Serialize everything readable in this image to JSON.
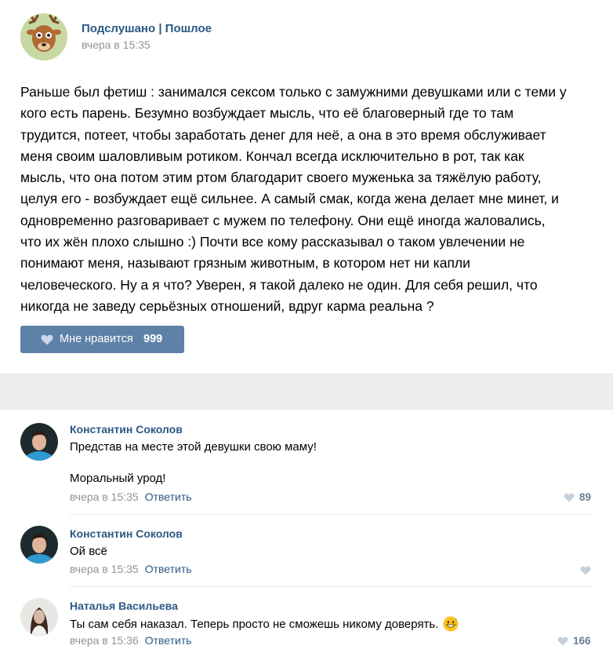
{
  "post": {
    "group_name": "Подслушано | Пошлое",
    "time": "вчера в 15:35",
    "lines": [
      "Раньше был фетиш : занимался сексом только с замужними девушками или с теми у",
      "кого есть парень. Безумно возбуждает мысль, что её благоверный где то там",
      "трудится, потеет, чтобы заработать денег для неё, а она в это время обслуживает",
      "меня своим шаловливым ротиком. Кончал всегда исключительно в рот, так как",
      "мысль, что она потом этим ртом благодарит своего муженька за тяжёлую работу,",
      "целуя его - возбуждает ещё сильнее. А самый смак, когда жена делает мне минет, и",
      "одновременно разговаривает с мужем по телефону. Они ещё иногда жаловались,",
      "что их жён плохо слышно :) Почти все кому рассказывал о таком увлечении не",
      "понимают меня, называют грязным животным, в котором нет ни капли",
      "человеческого. Ну а я что? Уверен, я такой далеко не один. Для себя решил, что",
      "никогда не заведу серьёзных отношений, вдруг карма реальна ?"
    ],
    "like_label": "Мне нравится",
    "like_count": "999"
  },
  "comments": [
    {
      "author": "Константин Соколов",
      "text_line1": "Представ на месте этой девушки свою маму!",
      "text_line2": "Моральный урод!",
      "time": "вчера в 15:35",
      "reply_label": "Ответить",
      "likes": "89"
    },
    {
      "author": "Константин Соколов",
      "text_line1": "Ой всё",
      "time": "вчера в 15:35",
      "reply_label": "Ответить",
      "likes": ""
    },
    {
      "author": "Наталья Васильева",
      "text_line1": "Ты сам себя наказал. Теперь просто не сможешь никому доверять.",
      "time": "вчера в 15:36",
      "reply_label": "Ответить",
      "likes": "166"
    }
  ],
  "icons": {
    "like": "heart-icon",
    "emoji": "grinning-sweat-emoji"
  },
  "colors": {
    "link": "#2a5885",
    "like_button": "#5e81a8",
    "muted": "#939393",
    "like_heart": "#c5d0db"
  }
}
